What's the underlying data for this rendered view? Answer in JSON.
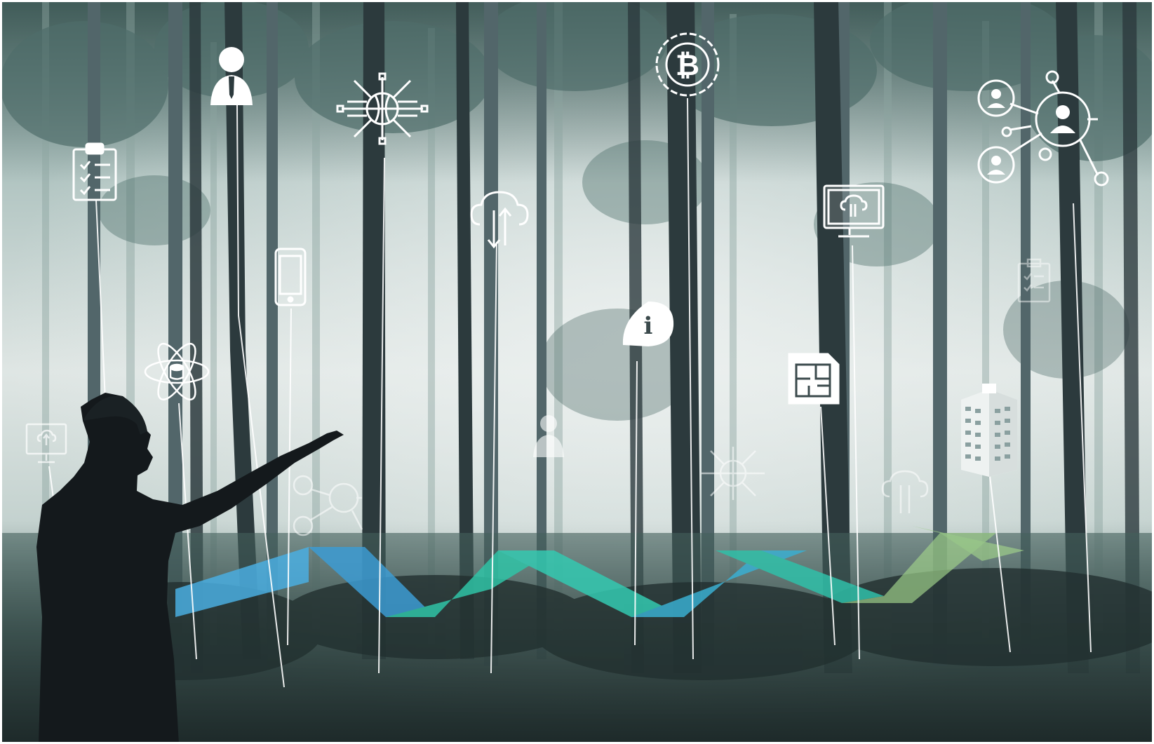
{
  "image": {
    "caption": "",
    "colors": {
      "fog_light": "#e7ecea",
      "fog_mid": "#b9cac6",
      "tree_dark": "#2c3a3d",
      "tree_mid": "#52666a",
      "foliage": "#4f6e6a",
      "undergrowth": "#22302f",
      "ribbon_blue": "#4aaee0",
      "ribbon_teal": "#2fc3a6",
      "ribbon_green": "#9fd08a",
      "silhouette": "#14191c",
      "icon_white": "#ffffff"
    },
    "icons": [
      "clipboard-checklist-icon",
      "businessman-icon",
      "global-network-icon",
      "bitcoin-icon",
      "people-network-icon",
      "smartphone-icon",
      "cloud-transfer-icon",
      "information-bubble-icon",
      "monitor-cloud-icon",
      "atom-database-icon",
      "floor-plan-icon",
      "office-building-icon",
      "monitor-upload-icon",
      "faded-people-network-icon",
      "faded-businessman-icon",
      "faded-global-network-icon",
      "faded-cloud-icon",
      "faded-clipboard-icon"
    ],
    "figure": "person-silhouette-pointing",
    "ribbon": "zigzag-arrow-ribbon"
  }
}
